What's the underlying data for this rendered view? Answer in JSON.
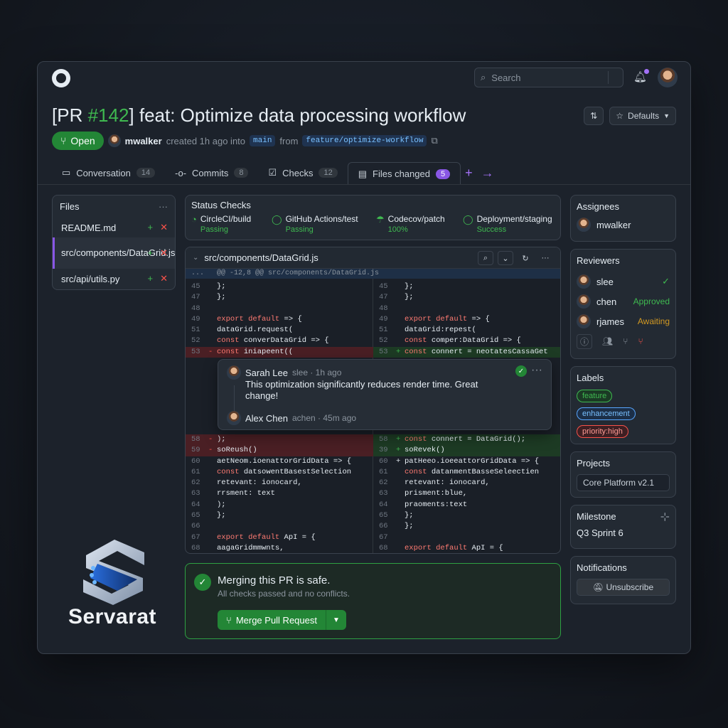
{
  "search": {
    "placeholder": "Search"
  },
  "pr": {
    "title_prefix": "[PR ",
    "number": "#142",
    "title_rest": "] feat: Optimize data processing workflow",
    "state": "Open",
    "author": "mwalker",
    "created": "created 1h ago into",
    "base": "main",
    "from": "from",
    "head": "feature/optimize-workflow",
    "defaults": "Defaults"
  },
  "tabs": [
    {
      "label": "Conversation",
      "count": "14"
    },
    {
      "label": "Commits",
      "count": "8"
    },
    {
      "label": "Checks",
      "count": "12"
    },
    {
      "label": "Files changed",
      "count": "5"
    }
  ],
  "files": {
    "title": "Files",
    "items": [
      "README.md",
      "src/components/DataGrid.js",
      "src/api/utils.py"
    ]
  },
  "status": {
    "title": "Status Checks",
    "checks": [
      {
        "name": "CircleCI/build",
        "state": "Passing"
      },
      {
        "name": "GitHub Actions/test",
        "state": "Passing"
      },
      {
        "name": "Codecov/patch",
        "state": "100%"
      },
      {
        "name": "Deployment/staging",
        "state": "Success"
      }
    ]
  },
  "diff": {
    "file": "src/components/DataGrid.js",
    "hunk": "@@ -12,8 @@ src/components/DataGrid.js"
  },
  "left_lines": [
    {
      "n": "45",
      "m": "",
      "t": "  };",
      "k": ""
    },
    {
      "n": "47",
      "m": "",
      "t": "  };",
      "k": ""
    },
    {
      "n": "48",
      "m": "",
      "t": "",
      "k": ""
    },
    {
      "n": "49",
      "m": "",
      "t": "  export default => {",
      "k": ""
    },
    {
      "n": "51",
      "m": "",
      "t": "    dataGrid.request(",
      "k": ""
    },
    {
      "n": "52",
      "m": "",
      "t": "      const converDataGrid => {",
      "k": ""
    },
    {
      "n": "53",
      "m": "-",
      "t": "      const iniapeent((",
      "k": "del"
    }
  ],
  "right_lines": [
    {
      "n": "45",
      "m": "",
      "t": "  };",
      "k": ""
    },
    {
      "n": "47",
      "m": "",
      "t": "  };",
      "k": ""
    },
    {
      "n": "48",
      "m": "",
      "t": "",
      "k": ""
    },
    {
      "n": "49",
      "m": "",
      "t": "  export default => {",
      "k": ""
    },
    {
      "n": "51",
      "m": "",
      "t": "    dataGrid:repest(",
      "k": ""
    },
    {
      "n": "52",
      "m": "",
      "t": "      const comper:DataGrid => {",
      "k": ""
    },
    {
      "n": "53",
      "m": "+",
      "t": "      const connert = neotatesCassaGet",
      "k": "add"
    }
  ],
  "left_lines2": [
    {
      "n": "58",
      "m": "-",
      "t": "    );",
      "k": "del"
    },
    {
      "n": "59",
      "m": "-",
      "t": "    soReush()",
      "k": "del"
    },
    {
      "n": "60",
      "m": "",
      "t": "    aetNeom.ioenattorGridData => {",
      "k": ""
    },
    {
      "n": "61",
      "m": "",
      "t": "      const datsowentBasestSelection",
      "k": ""
    },
    {
      "n": "62",
      "m": "",
      "t": "      retevant: ionocard,",
      "k": ""
    },
    {
      "n": "63",
      "m": "",
      "t": "      rrsment: text",
      "k": ""
    },
    {
      "n": "64",
      "m": "",
      "t": "    );",
      "k": ""
    },
    {
      "n": "65",
      "m": "",
      "t": "  };",
      "k": ""
    },
    {
      "n": "66",
      "m": "",
      "t": "",
      "k": ""
    },
    {
      "n": "67",
      "m": "",
      "t": "    export default ApI = {",
      "k": ""
    },
    {
      "n": "68",
      "m": "",
      "t": "      aagaGridmmwnts,",
      "k": ""
    }
  ],
  "right_lines2": [
    {
      "n": "58",
      "m": "+",
      "t": "      const connert = DataGrid();",
      "k": "add"
    },
    {
      "n": "39",
      "m": "+",
      "t": "    soRevek()",
      "k": "add"
    },
    {
      "n": "60",
      "m": "+",
      "t": "    patHeeo.ioeeattorGridData => {",
      "k": ""
    },
    {
      "n": "61",
      "m": "",
      "t": "      const datanmentBasseSeleectien",
      "k": ""
    },
    {
      "n": "62",
      "m": "",
      "t": "      retevant: ionocard,",
      "k": ""
    },
    {
      "n": "63",
      "m": "",
      "t": "      prisment:blue,",
      "k": ""
    },
    {
      "n": "64",
      "m": "",
      "t": "      praoments:text",
      "k": ""
    },
    {
      "n": "65",
      "m": "",
      "t": "    };",
      "k": ""
    },
    {
      "n": "66",
      "m": "",
      "t": "  };",
      "k": ""
    },
    {
      "n": "67",
      "m": "",
      "t": "",
      "k": ""
    },
    {
      "n": "68",
      "m": "",
      "t": "    export default ApI = {",
      "k": ""
    }
  ],
  "comment": {
    "author": "Sarah Lee",
    "handle": "slee · 1h ago",
    "body": "This optimization significantly reduces render time. Great change!",
    "reply_author": "Alex Chen",
    "reply_handle": "achen · 45m ago"
  },
  "merge": {
    "title": "Merging this PR is safe.",
    "sub": "All checks passed and no conflicts.",
    "button": "Merge Pull Request"
  },
  "assignees": {
    "title": "Assignees",
    "user": "mwalker"
  },
  "reviewers": {
    "title": "Reviewers",
    "items": [
      {
        "name": "slee",
        "status": "✓"
      },
      {
        "name": "chen",
        "status": "Approved"
      },
      {
        "name": "rjames",
        "status": "Awaiting"
      }
    ]
  },
  "labels": {
    "title": "Labels",
    "items": [
      {
        "name": "feature",
        "color": "#3fb950"
      },
      {
        "name": "enhancement",
        "color": "#58a6ff"
      },
      {
        "name": "priority:high",
        "color": "#f85149"
      }
    ]
  },
  "projects": {
    "title": "Projects",
    "value": "Core Platform v2.1"
  },
  "milestone": {
    "title": "Milestone",
    "value": "Q3 Sprint 6"
  },
  "notifications": {
    "title": "Notifications",
    "button": "Unsubscribe"
  },
  "brand": {
    "name": "Servarat"
  }
}
